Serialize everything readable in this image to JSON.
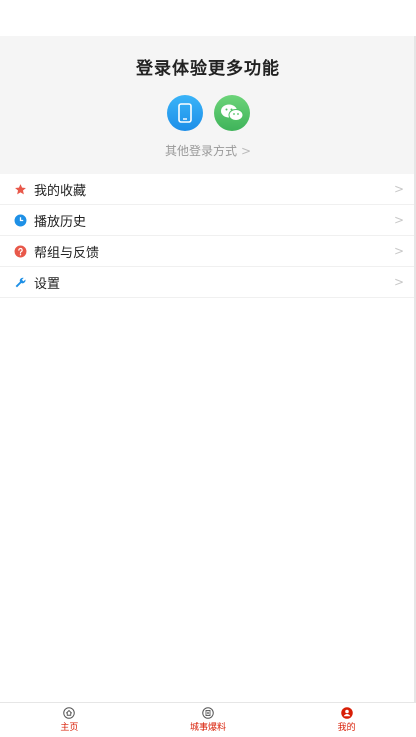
{
  "login": {
    "title": "登录体验更多功能",
    "other_methods": "其他登录方式",
    "phone_icon": "phone-icon",
    "wechat_icon": "wechat-icon"
  },
  "menu": {
    "items": [
      {
        "label": "我的收藏",
        "icon": "star-icon",
        "color": "#e8584a"
      },
      {
        "label": "播放历史",
        "icon": "clock-icon",
        "color": "#1e90e6"
      },
      {
        "label": "帮组与反馈",
        "icon": "question-icon",
        "color": "#e8584a"
      },
      {
        "label": "设置",
        "icon": "wrench-icon",
        "color": "#1e90e6"
      }
    ]
  },
  "tabbar": {
    "tabs": [
      {
        "label": "主页",
        "icon": "home-icon"
      },
      {
        "label": "城事爆料",
        "icon": "news-icon"
      },
      {
        "label": "我的",
        "icon": "user-icon"
      }
    ],
    "label_color": "#d81e06"
  }
}
